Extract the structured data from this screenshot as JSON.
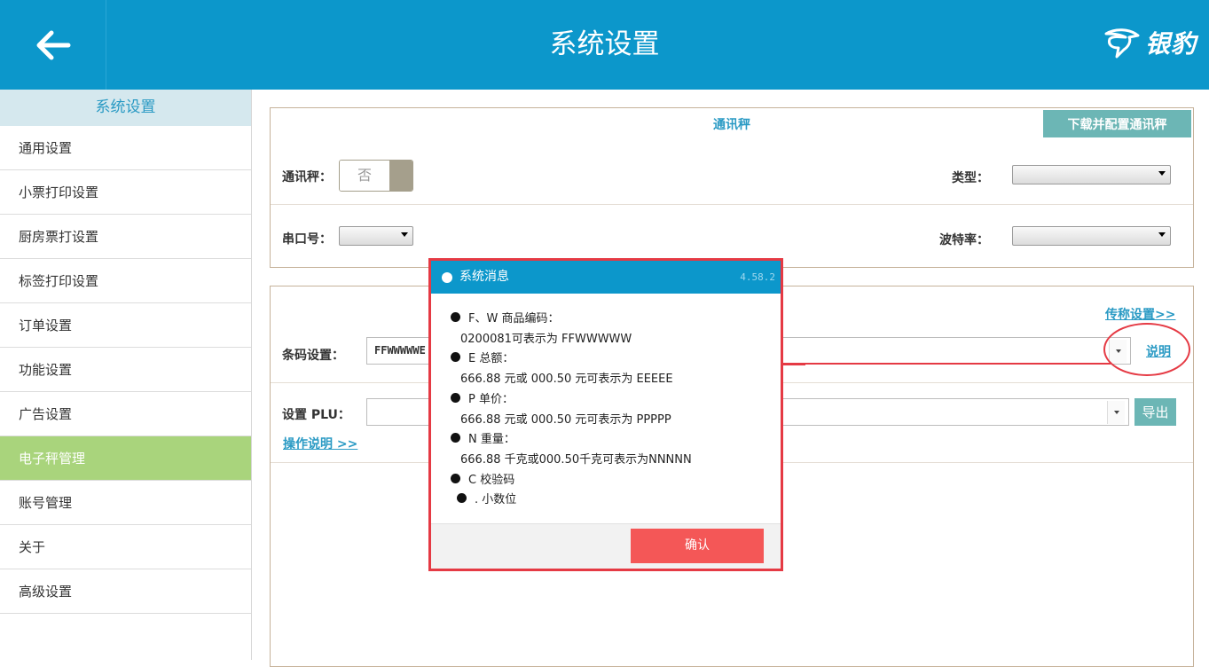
{
  "header": {
    "title": "系统设置",
    "logo_text": "银豹"
  },
  "sidebar": {
    "title": "系统设置",
    "items": [
      {
        "label": "通用设置"
      },
      {
        "label": "小票打印设置"
      },
      {
        "label": "厨房票打设置"
      },
      {
        "label": "标签打印设置"
      },
      {
        "label": "订单设置"
      },
      {
        "label": "功能设置"
      },
      {
        "label": "广告设置"
      },
      {
        "label": "电子秤管理",
        "active": true
      },
      {
        "label": "账号管理"
      },
      {
        "label": "关于"
      },
      {
        "label": "高级设置"
      }
    ]
  },
  "scale_panel": {
    "title": "通讯秤",
    "download_button": "下载并配置通讯秤",
    "scale_label": "通讯秤：",
    "scale_toggle_value": "否",
    "type_label": "类型：",
    "port_label": "串口号：",
    "baud_label": "波特率："
  },
  "barcode_panel": {
    "transfer_link": "传称设置>>",
    "barcode_label": "条码设置：",
    "barcode_value": "FFWWWWWE",
    "explain_link": "说明",
    "plu_label": "设置 PLU：",
    "export_button": "导出",
    "guide_link": "操作说明 >>"
  },
  "modal": {
    "title": "系统消息",
    "version": "4.58.2",
    "lines": [
      {
        "bullet": true,
        "text": "F、W 商品编码："
      },
      {
        "bullet": false,
        "text": "0200081可表示为 FFWWWWW"
      },
      {
        "bullet": true,
        "text": "E 总额："
      },
      {
        "bullet": false,
        "text": "666.88 元或 000.50 元可表示为 EEEEE"
      },
      {
        "bullet": true,
        "text": "P 单价："
      },
      {
        "bullet": false,
        "text": "666.88 元或 000.50 元可表示为 PPPPP"
      },
      {
        "bullet": true,
        "text": "N 重量："
      },
      {
        "bullet": false,
        "text": "666.88 千克或000.50千克可表示为NNNNN"
      },
      {
        "bullet": true,
        "text": "C 校验码"
      },
      {
        "bullet": true,
        "text": ". 小数位"
      }
    ],
    "confirm_button": "确认"
  },
  "colors": {
    "header_blue": "#0c97cb",
    "active_green": "#a9d47c",
    "teal_button": "#6cb6b5",
    "confirm_red": "#f45757",
    "annotation_red": "#e53a44"
  }
}
